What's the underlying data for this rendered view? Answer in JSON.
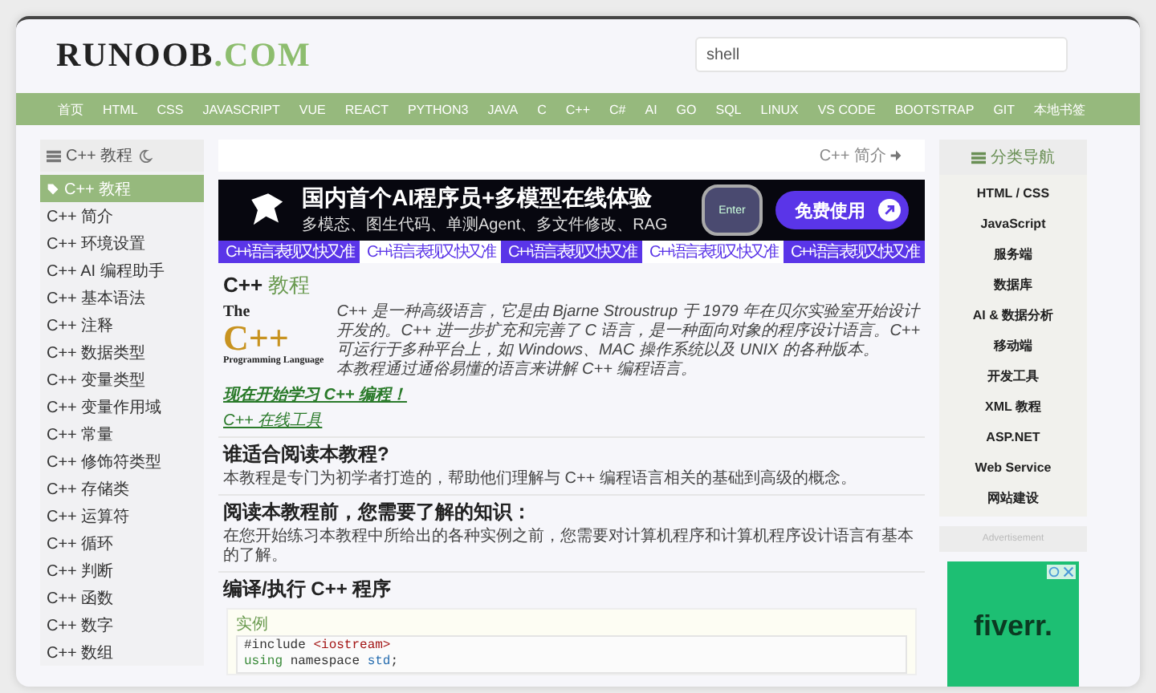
{
  "header": {
    "logo_main": "RUNOOB",
    "logo_accent": ".COM",
    "search": {
      "value": "shell"
    }
  },
  "nav": [
    "首页",
    "HTML",
    "CSS",
    "JAVASCRIPT",
    "VUE",
    "REACT",
    "PYTHON3",
    "JAVA",
    "C",
    "C++",
    "C#",
    "AI",
    "GO",
    "SQL",
    "LINUX",
    "VS CODE",
    "BOOTSTRAP",
    "GIT",
    "本地书签"
  ],
  "sidebar": {
    "title": "C++ 教程",
    "items": [
      {
        "label": "C++ 教程",
        "selected": true
      },
      {
        "label": "C++ 简介",
        "selected": false
      },
      {
        "label": "C++ 环境设置",
        "selected": false
      },
      {
        "label": "C++ AI 编程助手",
        "selected": false
      },
      {
        "label": "C++ 基本语法",
        "selected": false
      },
      {
        "label": "C++ 注释",
        "selected": false
      },
      {
        "label": "C++ 数据类型",
        "selected": false
      },
      {
        "label": "C++ 变量类型",
        "selected": false
      },
      {
        "label": "C++ 变量作用域",
        "selected": false
      },
      {
        "label": "C++ 常量",
        "selected": false
      },
      {
        "label": "C++ 修饰符类型",
        "selected": false
      },
      {
        "label": "C++ 存储类",
        "selected": false
      },
      {
        "label": "C++ 运算符",
        "selected": false
      },
      {
        "label": "C++ 循环",
        "selected": false
      },
      {
        "label": "C++ 判断",
        "selected": false
      },
      {
        "label": "C++ 函数",
        "selected": false
      },
      {
        "label": "C++ 数字",
        "selected": false
      },
      {
        "label": "C++ 数组",
        "selected": false
      }
    ]
  },
  "main": {
    "next_link": "C++ 简介",
    "banner": {
      "headline": "国内首个AI程序员+多模型在线体验",
      "subline": "多模态、图生代码、单测Agent、多文件修改、RAG",
      "key_label": "Enter",
      "cta": "免费使用"
    },
    "banner_tabs": [
      "C++语言表现又快又准",
      "C++语言表现又快又准",
      "C++语言表现又快又准",
      "C++语言表现又快又准",
      "C++语言表现又快又准"
    ],
    "title_plain": "C++",
    "title_accent": "教程",
    "book_logo": {
      "top": "The",
      "big": "C++",
      "bottom": "Programming Language"
    },
    "intro": [
      "C++ 是一种高级语言，它是由 Bjarne Stroustrup 于 1979 年在贝尔实验室开始设计开发的。C++ 进一步扩充和完善了 C 语言，是一种面向对象的程序设计语言。C++ 可运行于多种平台上，如 Windows、MAC 操作系统以及 UNIX 的各种版本。",
      "本教程通过通俗易懂的语言来讲解 C++ 编程语言。"
    ],
    "start_link": "现在开始学习 C++ 编程！",
    "tool_link": "C++ 在线工具",
    "sections": [
      {
        "heading": "谁适合阅读本教程?",
        "text": "本教程是专门为初学者打造的，帮助他们理解与 C++ 编程语言相关的基础到高级的概念。"
      },
      {
        "heading": "阅读本教程前，您需要了解的知识：",
        "text": "在您开始练习本教程中所给出的各种实例之前，您需要对计算机程序和计算机程序设计语言有基本的了解。"
      },
      {
        "heading": "编译/执行 C++ 程序"
      }
    ],
    "example": {
      "label": "实例",
      "lines": [
        [
          {
            "text": "#include ",
            "kind": "plain"
          },
          {
            "text": "<iostream>",
            "kind": "string"
          }
        ],
        [
          {
            "text": "using",
            "kind": "keyword"
          },
          {
            "text": " namespace ",
            "kind": "plain"
          },
          {
            "text": "std",
            "kind": "name"
          },
          {
            "text": ";",
            "kind": "plain"
          }
        ]
      ]
    }
  },
  "right": {
    "title": "分类导航",
    "items": [
      "HTML / CSS",
      "JavaScript",
      "服务端",
      "数据库",
      "AI & 数据分析",
      "移动端",
      "开发工具",
      "XML 教程",
      "ASP.NET",
      "Web Service",
      "网站建设"
    ],
    "ad_label": "Advertisement",
    "ad_logo": "fiverr."
  }
}
